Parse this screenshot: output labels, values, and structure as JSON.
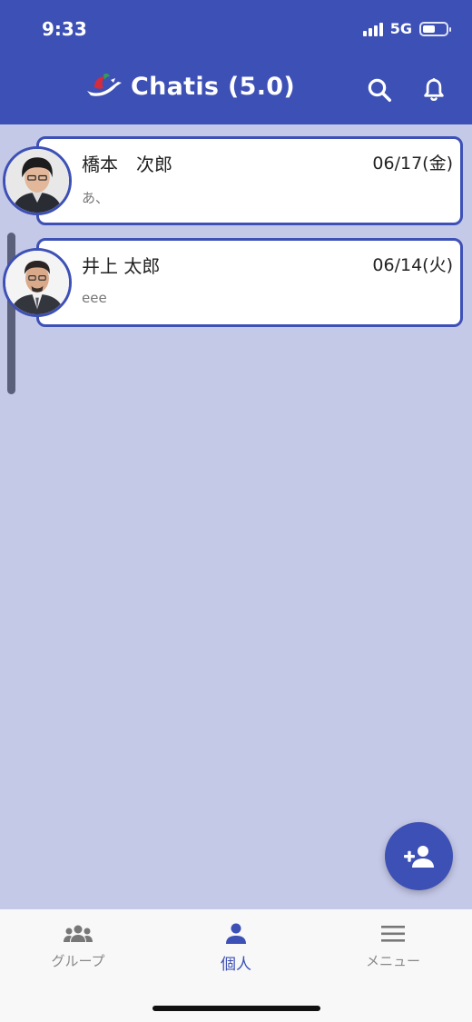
{
  "status_bar": {
    "time": "9:33",
    "network": "5G"
  },
  "header": {
    "title": "Chatis (5.0)",
    "logo_icon": "bird-logo",
    "actions": [
      "search-icon",
      "bell-icon"
    ]
  },
  "chats": [
    {
      "name": "橋本　次郎",
      "date": "06/17(金)",
      "last_message": "あ、"
    },
    {
      "name": "井上 太郎",
      "date": "06/14(火)",
      "last_message": "eee"
    }
  ],
  "fab": {
    "icon": "add-person-icon"
  },
  "bottom_nav": [
    {
      "label": "グループ",
      "icon": "group-icon",
      "active": false
    },
    {
      "label": "個人",
      "icon": "person-icon",
      "active": true
    },
    {
      "label": "メニュー",
      "icon": "menu-icon",
      "active": false
    }
  ],
  "colors": {
    "primary": "#3d50b5",
    "background": "#c5c9e8",
    "nav_background": "#f8f8f8"
  }
}
